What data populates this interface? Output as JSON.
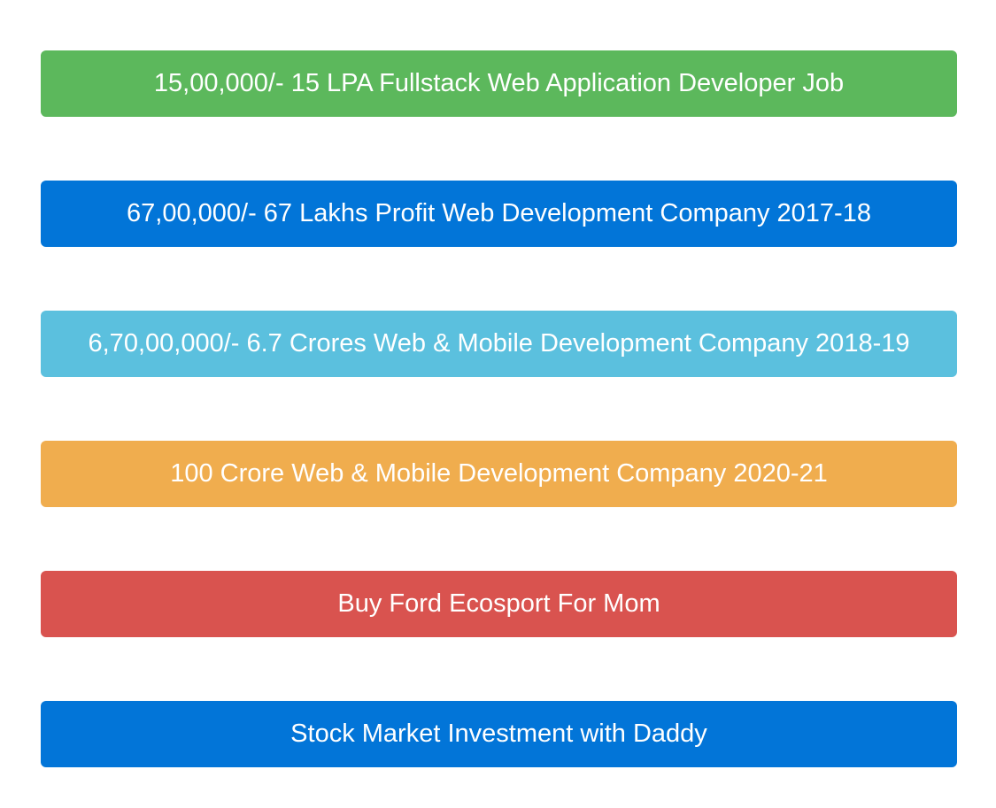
{
  "goals": [
    {
      "label": "15,00,000/- 15 LPA Fullstack Web Application Developer Job",
      "color": "#5cb85c"
    },
    {
      "label": "67,00,000/- 67 Lakhs Profit Web Development Company 2017-18",
      "color": "#0275d8"
    },
    {
      "label": "6,70,00,000/- 6.7 Crores Web & Mobile Development Company 2018-19",
      "color": "#5bc0de"
    },
    {
      "label": "100 Crore Web & Mobile Development Company 2020-21",
      "color": "#f0ad4e"
    },
    {
      "label": "Buy Ford Ecosport For Mom",
      "color": "#d9534f"
    },
    {
      "label": "Stock Market Investment with Daddy",
      "color": "#0275d8"
    }
  ]
}
